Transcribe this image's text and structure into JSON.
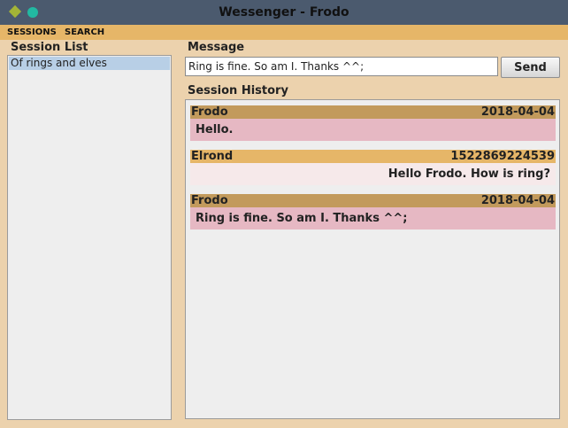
{
  "window": {
    "title": "Wessenger - Frodo",
    "icons": [
      "diamond-icon",
      "circle-icon"
    ],
    "colors": {
      "titlebar": "#4b5a6e",
      "menubar": "#e6b668",
      "background": "#ecd2ad"
    }
  },
  "menu": {
    "items": [
      "SESSIONS",
      "SEARCH"
    ]
  },
  "sidebar": {
    "label": "Session List",
    "sessions": [
      "Of rings and elves"
    ],
    "selected_color": "#b8cfe6"
  },
  "composer": {
    "label": "Message",
    "value": "Ring is fine. So am I. Thanks ^^;",
    "send_label": "Send"
  },
  "history": {
    "label": "Session History",
    "messages": [
      {
        "sender": "Frodo",
        "stamp": "2018-04-04",
        "text": "Hello.",
        "own": true
      },
      {
        "sender": "Elrond",
        "stamp": "1522869224539",
        "text": "Hello Frodo. How is ring?",
        "own": false
      },
      {
        "sender": "Frodo",
        "stamp": "2018-04-04",
        "text": "Ring is fine. So am I. Thanks ^^;",
        "own": true
      }
    ],
    "colors": {
      "own_header": "#c29a5c",
      "own_body": "#e6b8c3",
      "other_header": "#e6b668",
      "other_body": "#f6e9ea"
    }
  }
}
